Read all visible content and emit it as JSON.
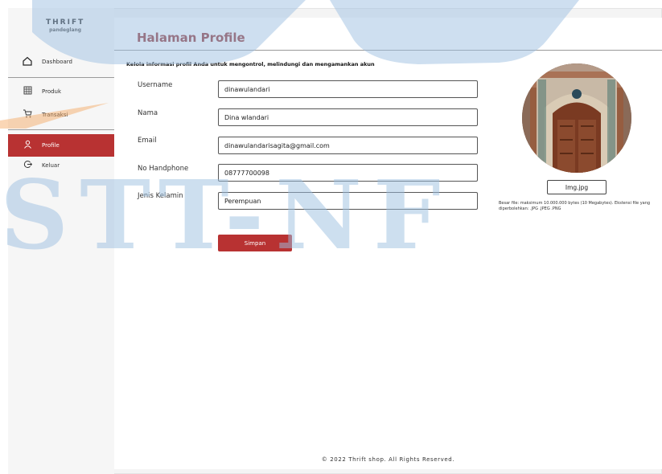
{
  "brand": {
    "name": "THRIFT",
    "sub": "pandeglang"
  },
  "sidebar": {
    "items": [
      {
        "label": "Dashboard",
        "icon": "home-icon"
      },
      {
        "label": "Produk",
        "icon": "grid-icon"
      },
      {
        "label": "Transaksi",
        "icon": "cart-icon"
      },
      {
        "label": "Profile",
        "icon": "user-icon",
        "active": true
      },
      {
        "label": "Keluar",
        "icon": "logout-icon"
      }
    ]
  },
  "page": {
    "title": "Halaman Profile",
    "subtitle": "Kelola informasi profil Anda untuk mengontrol, melindungi dan mengamankan akun"
  },
  "form": {
    "username_label": "Username",
    "username_value": "dinawulandari",
    "nama_label": "Nama",
    "nama_value": "Dina wlandari",
    "email_label": "Email",
    "email_value": "dinawulandarisagita@gmail.com",
    "phone_label": "No Handphone",
    "phone_value": "08777700098",
    "gender_label": "Jenis Kelamin",
    "gender_value": "Perempuan",
    "save_label": "Simpan"
  },
  "photo": {
    "file_button_label": "Img.jpg",
    "note": "Besar file: maksimum 10.000.000 bytes (10 Megabytes). Ekstensi file yang diperbolehkan: .JPG .JPEG .PNG"
  },
  "footer": {
    "text": "© 2022 Thrift shop. All Rights Reserved."
  },
  "watermark": {
    "text": "STT-NF"
  },
  "colors": {
    "accent": "#b83232",
    "title": "#8f2d2d",
    "watermark": "#9dc0e1"
  }
}
